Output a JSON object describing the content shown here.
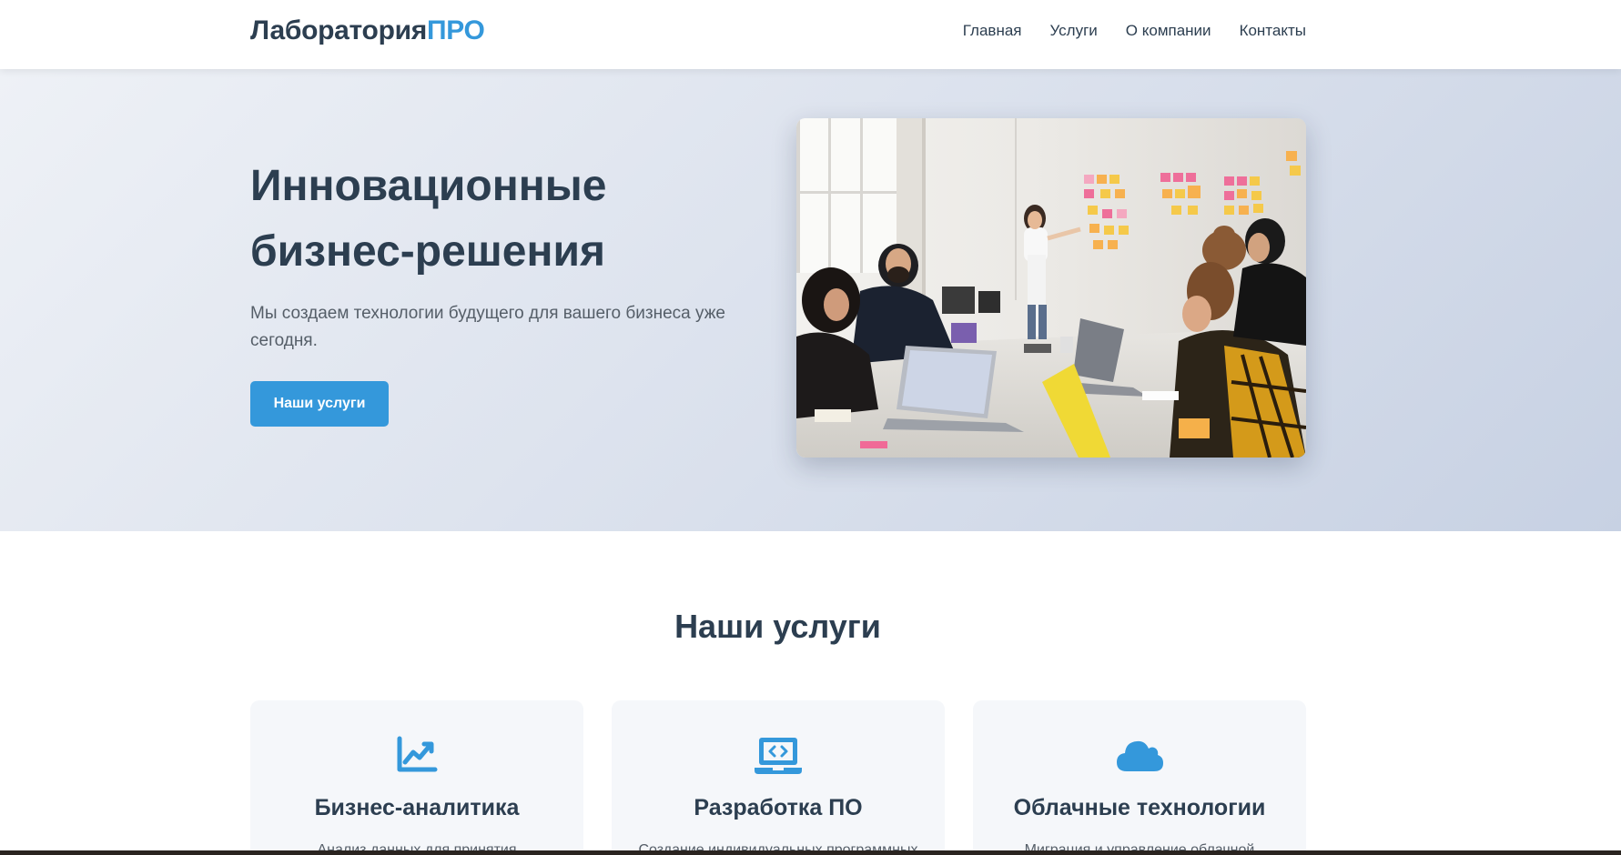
{
  "header": {
    "logo_main": "Лаборатория",
    "logo_accent": "ПРО",
    "nav": [
      "Главная",
      "Услуги",
      "О компании",
      "Контакты"
    ]
  },
  "hero": {
    "title": "Инновационные бизнес-решения",
    "subtitle": "Мы создаем технологии будущего для вашего бизнеса уже сегодня.",
    "button": "Наши услуги"
  },
  "services": {
    "title": "Наши услуги",
    "cards": [
      {
        "icon": "chart-line-icon",
        "title": "Бизнес-аналитика",
        "desc": "Анализ данных для принятия"
      },
      {
        "icon": "laptop-code-icon",
        "title": "Разработка ПО",
        "desc": "Создание индивидуальных программных"
      },
      {
        "icon": "cloud-icon",
        "title": "Облачные технологии",
        "desc": "Миграция и управление облачной"
      }
    ]
  },
  "colors": {
    "accent": "#3498db",
    "text": "#2c3e50"
  }
}
